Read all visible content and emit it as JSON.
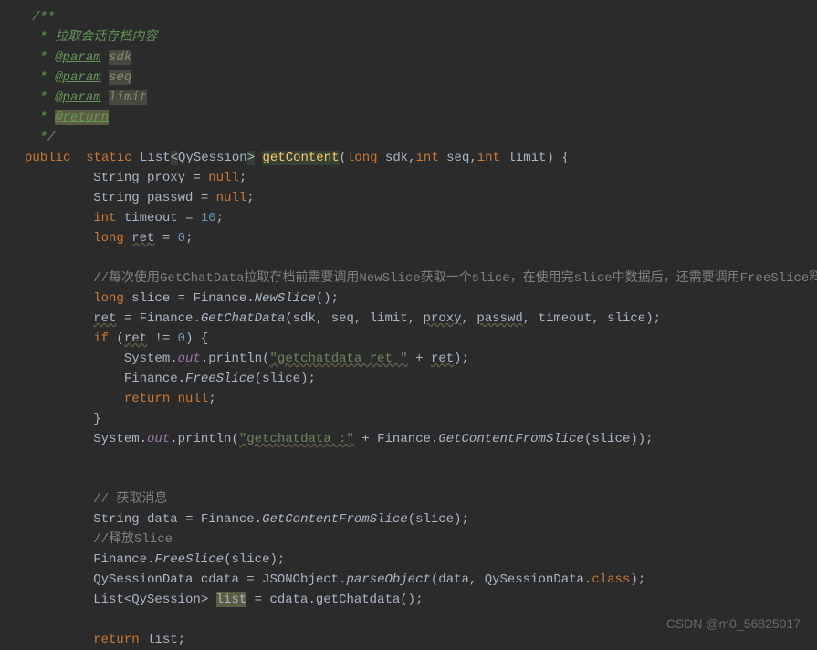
{
  "doc": {
    "open": "/**",
    "desc": " * 拉取会话存档内容",
    "paramTag": "@param",
    "returnTag": "@return",
    "p1": "sdk",
    "p2": "seq",
    "p3": "limit",
    "starSpace": " * ",
    "close": " */"
  },
  "sig": {
    "public": "public ",
    "static": " static ",
    "list": "List",
    "lt": "<",
    "qy": "QySession",
    "gt": ">",
    "sp": " ",
    "method": "getContent",
    "open": "(",
    "long": "long",
    "sdk": " sdk",
    "c1": ",",
    "int": "int",
    "seq": " seq",
    "c2": ",",
    "limit": " limit",
    "end": ") {"
  },
  "l1": {
    "t": "String proxy = ",
    "null": "null",
    "semi": ";"
  },
  "l2": {
    "t": "String passwd = ",
    "null": "null",
    "semi": ";"
  },
  "l3": {
    "int": "int",
    "t": " timeout = ",
    "n": "10",
    "semi": ";"
  },
  "l4": {
    "long": "long",
    "sp": " ",
    "ret": "ret",
    "eq": " = ",
    "n": "0",
    "semi": ";"
  },
  "c1": "//每次使用GetChatData拉取存档前需要调用NewSlice获取一个slice，在使用完slice中数据后，还需要调用FreeSlice释放。",
  "l5": {
    "long": "long",
    "t": " slice = Finance.",
    "m": "NewSlice",
    "end": "();"
  },
  "l6": {
    "ret": "ret",
    "t1": " = Finance.",
    "m": "GetChatData",
    "op": "(sdk, seq, limit, ",
    "proxy": "proxy",
    "c1": ", ",
    "passwd": "passwd",
    "t2": ", timeout, slice);"
  },
  "l7": {
    "if": "if",
    "op": " (",
    "ret": "ret",
    "ne": " != ",
    "n": "0",
    "end": ") {"
  },
  "l8": {
    "t1": "System.",
    "out": "out",
    "t2": ".println(",
    "s": "\"getchatdata ret \"",
    "plus": " + ",
    "ret": "ret",
    "end": ");"
  },
  "l9": {
    "t1": "Finance.",
    "m": "FreeSlice",
    "end": "(slice);"
  },
  "l10": {
    "ret": "return ",
    "null": "null",
    "semi": ";"
  },
  "l11": "}",
  "l12": {
    "t1": "System.",
    "out": "out",
    "t2": ".println(",
    "s": "\"getchatdata :\"",
    "plus": " + Finance.",
    "m": "GetContentFromSlice",
    "end": "(slice));"
  },
  "c2": "// 获取消息",
  "l13": {
    "t1": "String data = Finance.",
    "m": "GetContentFromSlice",
    "end": "(slice);"
  },
  "c3": "//释放Slice",
  "l14": {
    "t1": "Finance.",
    "m": "FreeSlice",
    "end": "(slice);"
  },
  "l15": {
    "t1": "QySessionData cdata = JSONObject.",
    "m": "parseObject",
    "t2": "(data, QySessionData.",
    "cls": "class",
    "end": ");"
  },
  "l16": {
    "t1": "List<QySession> ",
    "list": "list",
    "t2": " = cdata.getChatdata();"
  },
  "l17": {
    "ret": "return ",
    "t": "list;"
  },
  "watermark": "CSDN @m0_56825017"
}
